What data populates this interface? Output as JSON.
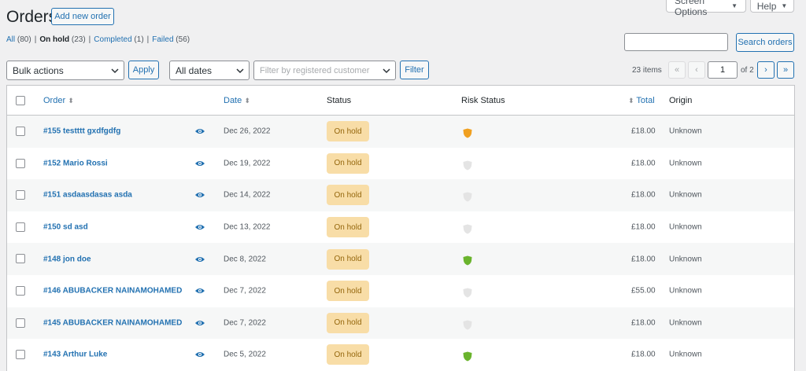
{
  "header": {
    "screen_options": "Screen Options",
    "help": "Help",
    "title": "Orders",
    "add_new": "Add new order"
  },
  "filters_links": [
    {
      "label": "All",
      "count": "(80)",
      "current": false
    },
    {
      "label": "On hold",
      "count": "(23)",
      "current": true
    },
    {
      "label": "Completed",
      "count": "(1)",
      "current": false
    },
    {
      "label": "Failed",
      "count": "(56)",
      "current": false
    }
  ],
  "search": {
    "value": "",
    "button": "Search orders"
  },
  "toolbar": {
    "bulk_actions": "Bulk actions",
    "apply": "Apply",
    "dates": "All dates",
    "customer_placeholder": "Filter by registered customer",
    "filter": "Filter"
  },
  "pagination": {
    "items": "23 items",
    "first": "«",
    "prev": "‹",
    "current_page": "1",
    "of": "of 2",
    "next": "›",
    "last": "»"
  },
  "columns": {
    "order": "Order",
    "date": "Date",
    "status": "Status",
    "risk": "Risk Status",
    "total": "Total",
    "origin": "Origin"
  },
  "colors": {
    "risk_orange": "#f0a020",
    "risk_green": "#6ab42d",
    "risk_grey": "#e4e4e4"
  },
  "rows": [
    {
      "order": "#155 testttt gxdfgdfg",
      "date": "Dec 26, 2022",
      "status": "On hold",
      "risk": "orange",
      "total": "£18.00",
      "origin": "Unknown"
    },
    {
      "order": "#152 Mario Rossi",
      "date": "Dec 19, 2022",
      "status": "On hold",
      "risk": "grey",
      "total": "£18.00",
      "origin": "Unknown"
    },
    {
      "order": "#151 asdaasdasas asda",
      "date": "Dec 14, 2022",
      "status": "On hold",
      "risk": "grey",
      "total": "£18.00",
      "origin": "Unknown"
    },
    {
      "order": "#150 sd asd",
      "date": "Dec 13, 2022",
      "status": "On hold",
      "risk": "grey",
      "total": "£18.00",
      "origin": "Unknown"
    },
    {
      "order": "#148 jon doe",
      "date": "Dec 8, 2022",
      "status": "On hold",
      "risk": "green",
      "total": "£18.00",
      "origin": "Unknown"
    },
    {
      "order": "#146 ABUBACKER NAINAMOHAMED",
      "date": "Dec 7, 2022",
      "status": "On hold",
      "risk": "grey",
      "total": "£55.00",
      "origin": "Unknown"
    },
    {
      "order": "#145 ABUBACKER NAINAMOHAMED",
      "date": "Dec 7, 2022",
      "status": "On hold",
      "risk": "grey",
      "total": "£18.00",
      "origin": "Unknown"
    },
    {
      "order": "#143 Arthur Luke",
      "date": "Dec 5, 2022",
      "status": "On hold",
      "risk": "green",
      "total": "£18.00",
      "origin": "Unknown"
    }
  ]
}
